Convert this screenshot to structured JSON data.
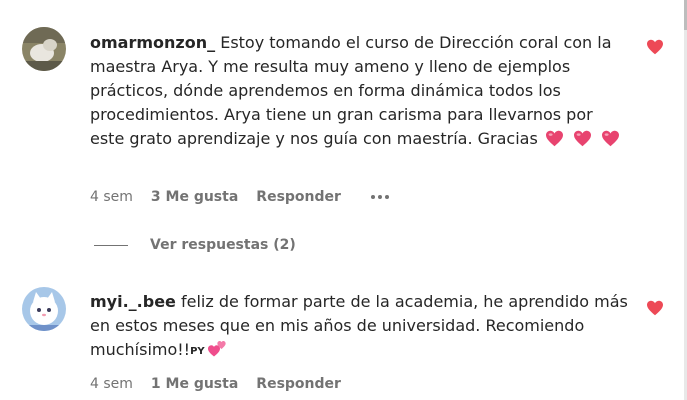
{
  "comments": [
    {
      "username": "omarmonzon_",
      "text": "Estoy tomando el curso de Dirección coral con la maestra Arya. Y me resulta muy ameno y lleno de ejemplos prácticos, dónde aprendemos en forma dinámica todos los procedimientos. Arya tiene un gran carisma para llevarnos por este grato aprendizaje y nos guía con maestría. Gracias",
      "age": "4 sem",
      "likes": "3 Me gusta",
      "reply": "Responder",
      "view_replies": "Ver respuestas (2)"
    },
    {
      "username": "myi._.bee",
      "text": "feliz de formar parte de la academia, he aprendido más en estos meses que en mis años de universidad. Recomiendo muchísimo!!",
      "badge": "PY",
      "age": "4 sem",
      "likes": "1 Me gusta",
      "reply": "Responder"
    }
  ],
  "colors": {
    "heart": "#ed4956",
    "meta_text": "#737373",
    "body_text": "#262626"
  },
  "icons": [
    "heart-icon",
    "pink-heart-emoji",
    "two-hearts-emoji",
    "more-options-icon"
  ]
}
